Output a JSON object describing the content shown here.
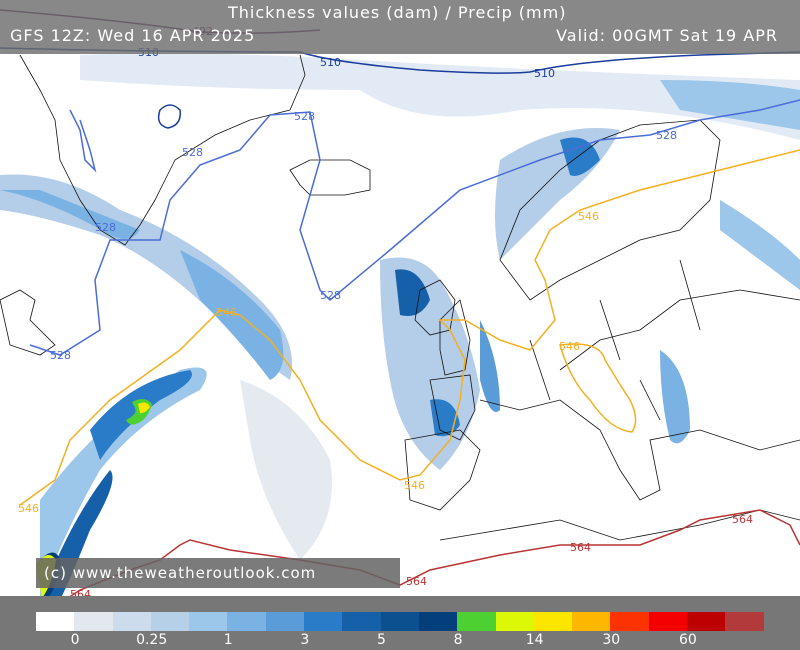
{
  "header": {
    "title": "Thickness values (dam) / Precip (mm)",
    "run": "GFS 12Z: Wed 16 APR 2025",
    "valid": "Valid: 00GMT Sat 19 APR"
  },
  "credit": "(c) www.theweatheroutlook.com",
  "legend": {
    "colors": [
      "#ffffff",
      "#e2e8ee",
      "#ccdcec",
      "#b6d0e8",
      "#9cc6ea",
      "#7ab2e4",
      "#5a9cd8",
      "#2b7cc8",
      "#1560a8",
      "#0c5090",
      "#043f7c",
      "#4cd032",
      "#dcf806",
      "#fce600",
      "#fcb800",
      "#fc3200",
      "#f40000",
      "#bc0000",
      "#b23a3a"
    ],
    "ticks": [
      {
        "label": "0",
        "index": 1
      },
      {
        "label": "0.25",
        "index": 3
      },
      {
        "label": "1",
        "index": 5
      },
      {
        "label": "3",
        "index": 7
      },
      {
        "label": "5",
        "index": 9
      },
      {
        "label": "8",
        "index": 11
      },
      {
        "label": "14",
        "index": 13
      },
      {
        "label": "30",
        "index": 15
      },
      {
        "label": "60",
        "index": 17
      }
    ]
  },
  "contours": {
    "c492": {
      "label": "492",
      "color": "#5a2050"
    },
    "c510": {
      "label": "510",
      "color": "#1a3c9c"
    },
    "c528": {
      "label": "528",
      "color": "#4a6cd8"
    },
    "c546": {
      "label": "546",
      "color": "#f4b022"
    },
    "c564": {
      "label": "564",
      "color": "#b83434"
    }
  }
}
